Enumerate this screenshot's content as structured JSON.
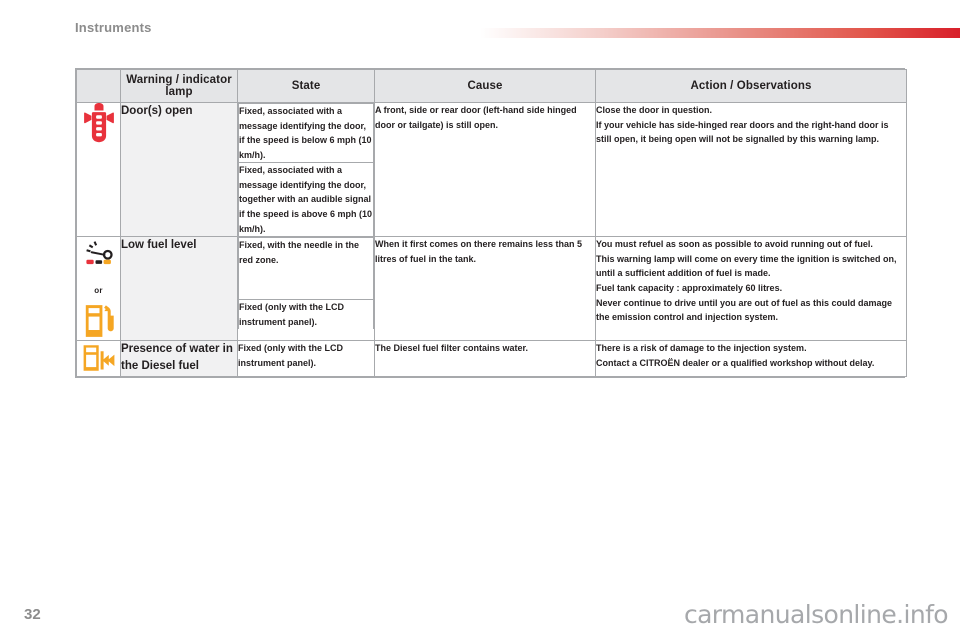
{
  "document": {
    "chapter_title": "Instruments",
    "page_number": "32",
    "watermark": "carmanualsonline.info",
    "accent_color": "#d81f2a"
  },
  "table": {
    "headers": [
      {
        "key": "icon",
        "label": ""
      },
      {
        "key": "lamp",
        "label": "Warning / indicator lamp"
      },
      {
        "key": "state",
        "label": "State"
      },
      {
        "key": "cause",
        "label": "Cause"
      },
      {
        "key": "action",
        "label": "Action / Observations"
      }
    ],
    "rows": [
      {
        "icon": "door-open-icon",
        "icon_color": "#e8323c",
        "lamp": "Door(s) open",
        "states": [
          "Fixed, associated with a message identifying the door, if the speed is below 6 mph (10 km/h).",
          "Fixed, associated with a message identifying the door, together with an audible signal if the speed is above 6 mph (10 km/h)."
        ],
        "cause": [
          "A front, side or rear door (left-hand side hinged door or tailgate) is still open."
        ],
        "action": [
          "Close the door in question.",
          "If your vehicle has side-hinged rear doors and the right-hand door is still open, it being open will not be signalled by this warning lamp."
        ]
      },
      {
        "icon": "fuel-gauge-icon",
        "icon_color": "#f5a623",
        "icon_secondary": "fuel-pump-icon",
        "or_label": "or",
        "lamp": "Low fuel level",
        "states": [
          "Fixed, with the needle in the red zone.",
          "Fixed (only with the LCD instrument panel)."
        ],
        "cause": [
          "When it first comes on there remains less than 5 litres of fuel in the tank."
        ],
        "action": [
          "You must refuel as soon as possible to avoid running out of fuel.",
          "This warning lamp will come on every time the ignition is switched on, until a sufficient addition of fuel is made.",
          "Fuel tank capacity : approximately 60 litres.",
          "Never continue to drive until you are out of fuel as this could damage the emission control and injection system."
        ]
      },
      {
        "icon": "water-in-diesel-icon",
        "icon_color": "#f5a623",
        "lamp": "Presence of water in the Diesel fuel",
        "states": [
          "Fixed (only with the LCD instrument panel)."
        ],
        "cause": [
          "The Diesel fuel filter contains water."
        ],
        "action": [
          "There is a risk of damage to the injection system.",
          "Contact a CITROËN dealer or a qualified workshop without delay."
        ]
      }
    ]
  }
}
